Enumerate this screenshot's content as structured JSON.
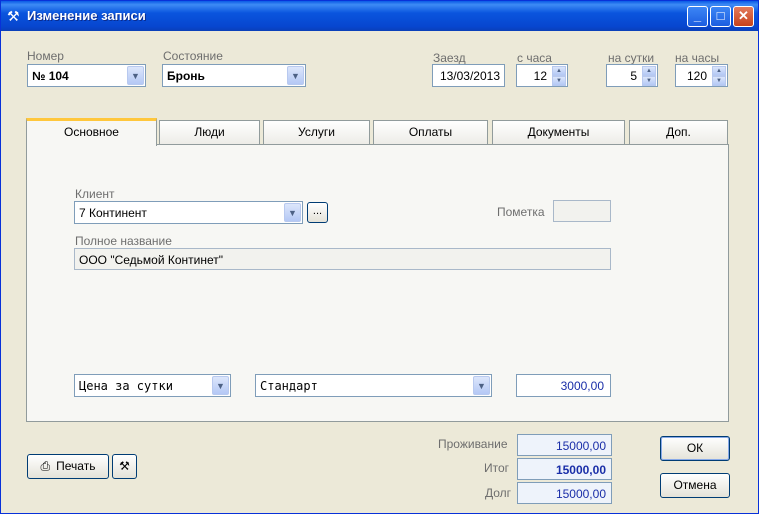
{
  "window": {
    "title": "Изменение записи"
  },
  "header": {
    "room_label": "Номер",
    "room_value": "№ 104",
    "state_label": "Состояние",
    "state_value": "Бронь",
    "checkin_label": "Заезд",
    "checkin_value": "13/03/2013",
    "hour_label": "с часа",
    "hour_value": "12",
    "days_label": "на сутки",
    "days_value": "5",
    "hours_label": "на часы",
    "hours_value": "120"
  },
  "tabs": [
    {
      "label": "Основное"
    },
    {
      "label": "Люди"
    },
    {
      "label": "Услуги"
    },
    {
      "label": "Оплаты"
    },
    {
      "label": "Документы"
    },
    {
      "label": "Доп."
    }
  ],
  "main": {
    "client_label": "Клиент",
    "client_value": "7 Континент",
    "ellipsis_label": "...",
    "mark_label": "Пометка",
    "mark_value": "",
    "fullname_label": "Полное название",
    "fullname_value": "ООО \"Седьмой Континет\"",
    "price_type_value": "Цена за сутки",
    "tariff_value": "Стандарт",
    "price_value": "3000,00"
  },
  "footer": {
    "print_label": "Печать",
    "living_label": "Проживание",
    "living_value": "15000,00",
    "total_label": "Итог",
    "total_value": "15000,00",
    "debt_label": "Долг",
    "debt_value": "15000,00",
    "ok_label": "ОК",
    "cancel_label": "Отмена"
  }
}
